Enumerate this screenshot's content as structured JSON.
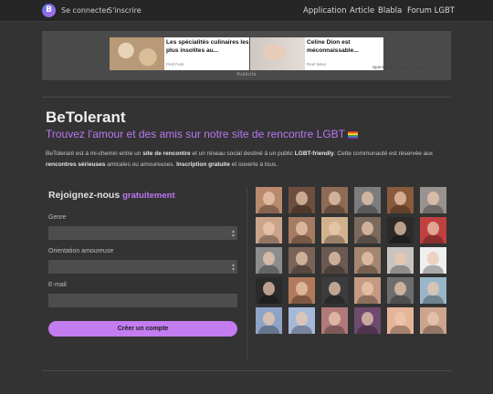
{
  "topbar": {
    "logo_letter": "B",
    "login": "Se connecter",
    "signup": "S'inscrire",
    "nav": [
      "Application",
      "Article",
      "Blabla",
      "Forum LGBT"
    ]
  },
  "ad": {
    "cards": [
      {
        "title": "Les spécialités culinaires les plus insolites au...",
        "source": "Petit Futé",
        "thumb_color": "#c9b08f"
      },
      {
        "title": "Celine Dion est méconnaissable...",
        "source": "Reel Wear",
        "thumb_color": "#d8c2b4"
      }
    ],
    "sponsored": "Sponsored Links by Taboola",
    "label": "Publicité"
  },
  "hero": {
    "brand": "BeTolerant",
    "tagline": "Trouvez l'amour et des amis sur notre site de rencontre LGBT",
    "desc": [
      {
        "t": "BeTolerant est à mi-chemin entre un ",
        "b": false
      },
      {
        "t": "site de rencontre",
        "b": true
      },
      {
        "t": " et un réseau social destiné à un public ",
        "b": false
      },
      {
        "t": "LGBT-friendly",
        "b": true
      },
      {
        "t": ". Cette communauté est réservée aux ",
        "b": false
      },
      {
        "t": "rencontres sérieuses",
        "b": true
      },
      {
        "t": " amicales ou amoureuses. ",
        "b": false
      },
      {
        "t": "Inscription gratuite",
        "b": true
      },
      {
        "t": " et ouverte à tous.",
        "b": false
      }
    ]
  },
  "form": {
    "heading": "Rejoignez-nous",
    "heading_accent": "gratuitement",
    "genre_label": "Genre",
    "orientation_label": "Orientation amoureuse",
    "email_label": "E-mail",
    "email_value": "",
    "submit": "Créer un compte"
  },
  "profiles": {
    "colors": [
      [
        "#b98a6d",
        "#6e4f3f",
        "#8d6b55",
        "#7d7d7d",
        "#8a5a3c",
        "#9a9290"
      ],
      [
        "#c9a48b",
        "#a57c62",
        "#d2b28e",
        "#7c6a5c",
        "#2e2a2a",
        "#c04040"
      ],
      [
        "#8d8d8d",
        "#7a6458",
        "#6b5a52",
        "#a58670",
        "#c9c4bf",
        "#efefef"
      ],
      [
        "#2b2b2b",
        "#b27a5c",
        "#3c3c3c",
        "#c59a82",
        "#6e6e6e",
        "#9ab6c9"
      ],
      [
        "#8fa3c7",
        "#a7b9d9",
        "#b07a7a",
        "#6e4a6e",
        "#e6b499",
        "#cda58e"
      ]
    ]
  }
}
